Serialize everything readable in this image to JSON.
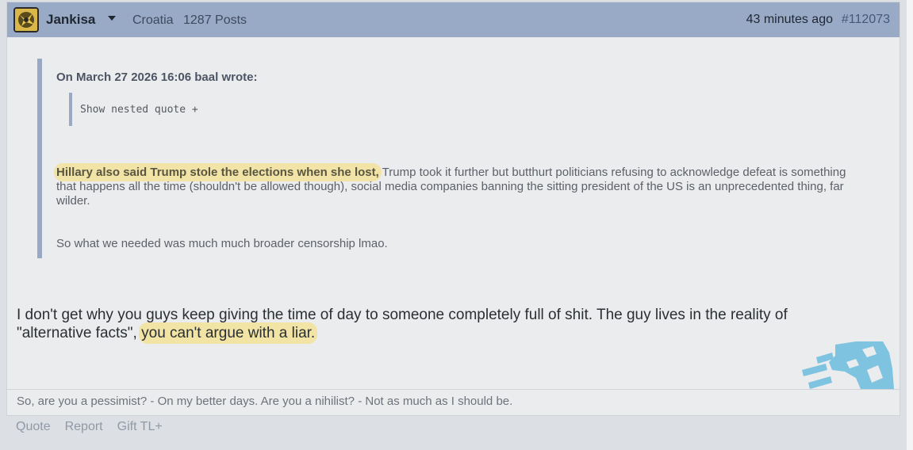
{
  "post": {
    "author": {
      "username": "Jankisa",
      "country": "Croatia",
      "post_count": "1287 Posts",
      "avatar_icon": "starcraft-race-avatar-icon"
    },
    "time_ago": "43 minutes ago",
    "post_id": "#112073",
    "quote": {
      "attribution": "On March 27 2026 16:06 baal wrote:",
      "nested_toggle": "Show nested quote +",
      "paragraph1_highlight": "Hillary also said Trump stole the elections when she lost,",
      "paragraph1_rest": " Trump took it further but butthurt politicians refusing to acknowledge defeat is something that happens all the time (shouldn't be allowed though), social media companies banning the sitting president of the US is an unprecedented thing, far wilder.",
      "paragraph2": "So what we needed was much much broader censorship lmao."
    },
    "body": {
      "text": "I don't get why you guys keep giving the time of day to someone completely full of shit. The guy lives in the reality of \"alternative facts\", ",
      "highlight": "you can't argue with a liar."
    },
    "signature": "So, are you a pessimist? - On my better days. Are you a nihilist? - Not as much as I should be.",
    "team_logo_icon": "team-liquid-horse-icon"
  },
  "actions": {
    "quote": "Quote",
    "report": "Report",
    "gift": "Gift TL+"
  },
  "colors": {
    "header_bg": "#99aac6",
    "quote_border": "#9aa8c4",
    "highlight": "#f1e4a4",
    "logo": "#7ec3df"
  }
}
